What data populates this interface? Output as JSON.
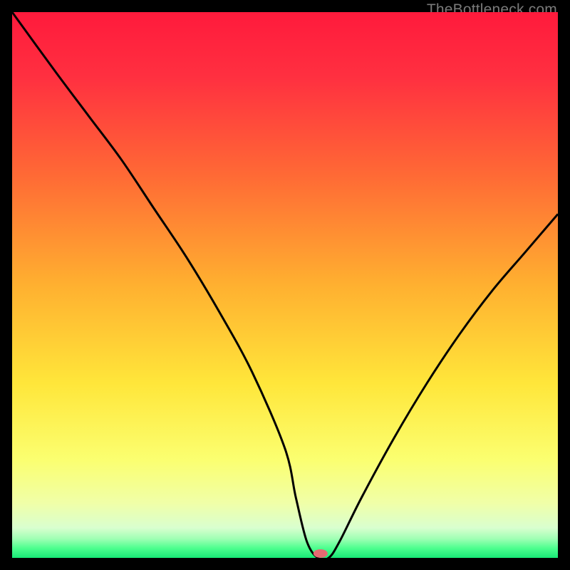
{
  "attribution": "TheBottleneck.com",
  "chart_data": {
    "type": "line",
    "title": "",
    "xlabel": "",
    "ylabel": "",
    "xlim": [
      0,
      100
    ],
    "ylim": [
      0,
      100
    ],
    "grid": false,
    "legend": false,
    "series": [
      {
        "name": "bottleneck-curve",
        "x": [
          0,
          8,
          14,
          20,
          26,
          32,
          38,
          44,
          50,
          52,
          54,
          56,
          58,
          60,
          64,
          70,
          76,
          82,
          88,
          94,
          100
        ],
        "values": [
          100,
          89,
          81,
          73,
          64,
          55,
          45,
          34,
          20,
          11,
          3,
          0,
          0,
          3,
          11,
          22,
          32,
          41,
          49,
          56,
          63
        ]
      }
    ],
    "marker": {
      "x": 56.5,
      "y": 0.8,
      "color": "#e46a72"
    },
    "background_gradient": {
      "stops": [
        {
          "offset": 0.0,
          "color": "#ff1a3c"
        },
        {
          "offset": 0.12,
          "color": "#ff3040"
        },
        {
          "offset": 0.3,
          "color": "#ff6a35"
        },
        {
          "offset": 0.5,
          "color": "#ffb030"
        },
        {
          "offset": 0.68,
          "color": "#ffe63a"
        },
        {
          "offset": 0.82,
          "color": "#fbff70"
        },
        {
          "offset": 0.9,
          "color": "#f0ffa8"
        },
        {
          "offset": 0.945,
          "color": "#d9ffcf"
        },
        {
          "offset": 0.965,
          "color": "#9fffb4"
        },
        {
          "offset": 0.982,
          "color": "#4eff8f"
        },
        {
          "offset": 1.0,
          "color": "#18e876"
        }
      ]
    },
    "curve_stroke": "#000000",
    "curve_width": 3
  }
}
